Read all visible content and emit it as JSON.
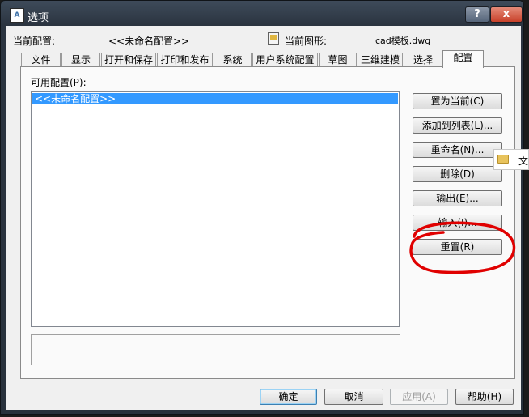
{
  "window": {
    "title": "选项",
    "app_icon_text": "A",
    "help_glyph": "?",
    "close_glyph": "x"
  },
  "header": {
    "current_profile_label": "当前配置:",
    "current_profile_value": "<<未命名配置>>",
    "current_drawing_label": "当前图形:",
    "current_drawing_value": "cad模板.dwg",
    "drawing_icon": "drawing-file-icon"
  },
  "tabs": [
    {
      "label": "文件"
    },
    {
      "label": "显示"
    },
    {
      "label": "打开和保存"
    },
    {
      "label": "打印和发布"
    },
    {
      "label": "系统"
    },
    {
      "label": "用户系统配置"
    },
    {
      "label": "草图"
    },
    {
      "label": "三维建模"
    },
    {
      "label": "选择"
    },
    {
      "label": "配置",
      "active": true
    }
  ],
  "profiles": {
    "label": "可用配置(P):",
    "items": [
      "<<未命名配置>>"
    ],
    "selected": "<<未命名配置>>"
  },
  "side_buttons": {
    "set_current": "置为当前(C)",
    "add_to_list": "添加到列表(L)...",
    "rename": "重命名(N)...",
    "delete": "删除(D)",
    "export": "输出(E)...",
    "import": "输入(I)...",
    "reset": "重置(R)"
  },
  "footer": {
    "ok": "确定",
    "cancel": "取消",
    "apply": "应用(A)",
    "help": "帮助(H)"
  },
  "explorer_tip": {
    "text": "文",
    "icon": "folder-icon"
  },
  "annotation": {
    "color": "#e00000",
    "target": "reset"
  },
  "colors": {
    "selection": "#3399ff",
    "dialog_bg": "#f0f0f0",
    "frame": "#2b3440"
  }
}
